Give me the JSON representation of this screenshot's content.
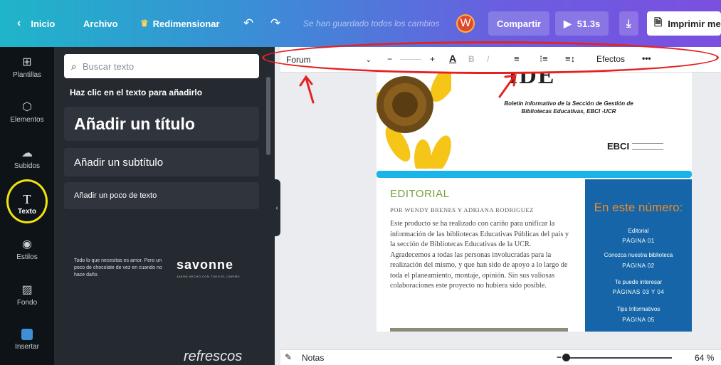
{
  "topbar": {
    "back_label": "Inicio",
    "file_label": "Archivo",
    "resize_label": "Redimensionar",
    "saved_status": "Se han guardado todos los cambios",
    "avatar_letter": "W",
    "share_label": "Compartir",
    "play_time": "51.3s",
    "print_label": "Imprimir me"
  },
  "leftnav": {
    "items": [
      {
        "label": "Plantillas",
        "icon": "layout-icon"
      },
      {
        "label": "Elementos",
        "icon": "shapes-icon"
      },
      {
        "label": "Subidos",
        "icon": "upload-icon"
      },
      {
        "label": "Texto",
        "icon": "text-icon"
      },
      {
        "label": "Estilos",
        "icon": "palette-icon"
      },
      {
        "label": "Fondo",
        "icon": "background-icon"
      },
      {
        "label": "Insertar",
        "icon": "embed-icon"
      }
    ]
  },
  "panel": {
    "search_placeholder": "Buscar texto",
    "hint": "Haz clic en el texto para añadirlo",
    "add_title": "Añadir un título",
    "add_subtitle": "Añadir un subtítulo",
    "add_body": "Añadir un poco de texto",
    "template_left_text": "Todo lo que necesitas es amor. Pero un poco de chocolate de vez en cuando no hace daño.",
    "template_right_title": "savonne",
    "template_right_sub": "JABÓN HECHO CON TODO EL CARIÑO",
    "template_bottom_text": "refrescos"
  },
  "toolbar": {
    "font": "Forum",
    "minus": "−",
    "plus": "+",
    "text_color": "A",
    "bold": "B",
    "italic": "I",
    "effects_label": "Efectos",
    "more": "•••"
  },
  "page": {
    "header_title_fragment": "IDE",
    "header_subtitle": "Boletín informativo de la Sección de Gestión de Bibliotecas Educativas, EBCI -UCR",
    "logo_text": "EBCI",
    "editorial_title": "EDITORIAL",
    "editorial_byline": "POR WENDY BRENES Y ADRIANA RODRIGUEZ",
    "editorial_body": "Este producto se ha realizado con cariño para unificar la información de las bibliotecas Educativas Públicas del país y la sección de Bibliotecas Educativas de la UCR. Agradecemos a todas las personas involucradas para la realización del mismo, y que han sido de apoyo a lo largo de toda el planeamiento, montaje, opinión. Sin sus valiosas colaboraciones este proyecto no hubiera sido posible.",
    "sidebar_title": "En este número:",
    "sidebar_items": [
      {
        "label": "Editorial",
        "page": "PÁGINA 01"
      },
      {
        "label": "Conozca nuestra biblioteca",
        "page": "PÁGINA 02"
      },
      {
        "label": "Te puede interesar",
        "page": "PÁGINAS 03 Y 04"
      },
      {
        "label": "Tips Informativos",
        "page": "PÁGINA 05"
      }
    ]
  },
  "bottombar": {
    "notes_label": "Notas",
    "zoom": "64 %"
  },
  "colors": {
    "accent_sidebar": "#1565a8",
    "editorial_green": "#7aa03a",
    "title_orange": "#f28b22",
    "stripe_cyan": "#19b4e8"
  }
}
